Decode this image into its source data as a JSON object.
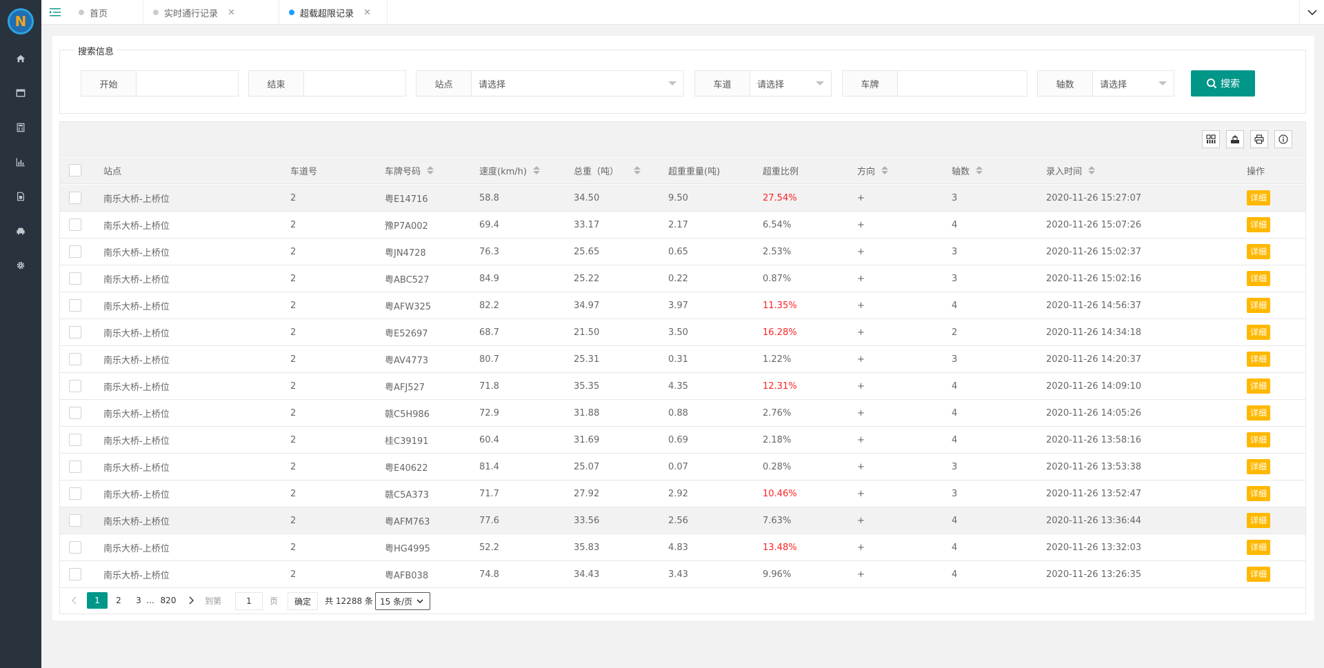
{
  "sidebar": {
    "logo_letter": "N",
    "items": [
      {
        "icon": "home-icon"
      },
      {
        "icon": "window-icon"
      },
      {
        "icon": "calculator-icon"
      },
      {
        "icon": "bar-chart-icon"
      },
      {
        "icon": "document-icon"
      },
      {
        "icon": "car-icon"
      },
      {
        "icon": "gear-icon"
      }
    ]
  },
  "tabs": [
    {
      "label": "首页",
      "active": false,
      "closable": false
    },
    {
      "label": "实时通行记录",
      "active": false,
      "closable": true
    },
    {
      "label": "超载超限记录",
      "active": true,
      "closable": true
    }
  ],
  "search": {
    "legend": "搜索信息",
    "start_label": "开始",
    "start_value": "",
    "end_label": "结束",
    "end_value": "",
    "station_label": "站点",
    "station_value": "请选择",
    "lane_label": "车道",
    "lane_value": "请选择",
    "plate_label": "车牌",
    "plate_value": "",
    "axle_label": "轴数",
    "axle_value": "请选择",
    "button_label": "搜索"
  },
  "table": {
    "columns": [
      "站点",
      "车道号",
      "车牌号码",
      "速度(km/h)",
      "总重（吨）",
      "超重重量(吨)",
      "超重比例",
      "方向",
      "轴数",
      "录入时间",
      "操作"
    ],
    "action_label": "详细",
    "rows": [
      {
        "station": "南乐大桥-上桥位",
        "lane": "2",
        "plate": "粤E14716",
        "speed": "58.8",
        "total": "34.50",
        "over": "9.50",
        "ratio": "27.54%",
        "red": true,
        "dir": "+",
        "axles": "3",
        "time": "2020-11-26 15:27:07"
      },
      {
        "station": "南乐大桥-上桥位",
        "lane": "2",
        "plate": "豫P7A002",
        "speed": "69.4",
        "total": "33.17",
        "over": "2.17",
        "ratio": "6.54%",
        "red": false,
        "dir": "+",
        "axles": "4",
        "time": "2020-11-26 15:07:26"
      },
      {
        "station": "南乐大桥-上桥位",
        "lane": "2",
        "plate": "粤JN4728",
        "speed": "76.3",
        "total": "25.65",
        "over": "0.65",
        "ratio": "2.53%",
        "red": false,
        "dir": "+",
        "axles": "3",
        "time": "2020-11-26 15:02:37"
      },
      {
        "station": "南乐大桥-上桥位",
        "lane": "2",
        "plate": "粤ABC527",
        "speed": "84.9",
        "total": "25.22",
        "over": "0.22",
        "ratio": "0.87%",
        "red": false,
        "dir": "+",
        "axles": "3",
        "time": "2020-11-26 15:02:16"
      },
      {
        "station": "南乐大桥-上桥位",
        "lane": "2",
        "plate": "粤AFW325",
        "speed": "82.2",
        "total": "34.97",
        "over": "3.97",
        "ratio": "11.35%",
        "red": true,
        "dir": "+",
        "axles": "4",
        "time": "2020-11-26 14:56:37"
      },
      {
        "station": "南乐大桥-上桥位",
        "lane": "2",
        "plate": "粤E52697",
        "speed": "68.7",
        "total": "21.50",
        "over": "3.50",
        "ratio": "16.28%",
        "red": true,
        "dir": "+",
        "axles": "2",
        "time": "2020-11-26 14:34:18"
      },
      {
        "station": "南乐大桥-上桥位",
        "lane": "2",
        "plate": "粤AV4773",
        "speed": "80.7",
        "total": "25.31",
        "over": "0.31",
        "ratio": "1.22%",
        "red": false,
        "dir": "+",
        "axles": "3",
        "time": "2020-11-26 14:20:37"
      },
      {
        "station": "南乐大桥-上桥位",
        "lane": "2",
        "plate": "粤AFJ527",
        "speed": "71.8",
        "total": "35.35",
        "over": "4.35",
        "ratio": "12.31%",
        "red": true,
        "dir": "+",
        "axles": "4",
        "time": "2020-11-26 14:09:10"
      },
      {
        "station": "南乐大桥-上桥位",
        "lane": "2",
        "plate": "赣C5H986",
        "speed": "72.9",
        "total": "31.88",
        "over": "0.88",
        "ratio": "2.76%",
        "red": false,
        "dir": "+",
        "axles": "4",
        "time": "2020-11-26 14:05:26"
      },
      {
        "station": "南乐大桥-上桥位",
        "lane": "2",
        "plate": "桂C39191",
        "speed": "60.4",
        "total": "31.69",
        "over": "0.69",
        "ratio": "2.18%",
        "red": false,
        "dir": "+",
        "axles": "4",
        "time": "2020-11-26 13:58:16"
      },
      {
        "station": "南乐大桥-上桥位",
        "lane": "2",
        "plate": "粤E40622",
        "speed": "81.4",
        "total": "25.07",
        "over": "0.07",
        "ratio": "0.28%",
        "red": false,
        "dir": "+",
        "axles": "3",
        "time": "2020-11-26 13:53:38"
      },
      {
        "station": "南乐大桥-上桥位",
        "lane": "2",
        "plate": "赣C5A373",
        "speed": "71.7",
        "total": "27.92",
        "over": "2.92",
        "ratio": "10.46%",
        "red": true,
        "dir": "+",
        "axles": "3",
        "time": "2020-11-26 13:52:47"
      },
      {
        "station": "南乐大桥-上桥位",
        "lane": "2",
        "plate": "粤AFM763",
        "speed": "77.6",
        "total": "33.56",
        "over": "2.56",
        "ratio": "7.63%",
        "red": false,
        "dir": "+",
        "axles": "4",
        "time": "2020-11-26 13:36:44"
      },
      {
        "station": "南乐大桥-上桥位",
        "lane": "2",
        "plate": "粤HG4995",
        "speed": "52.2",
        "total": "35.83",
        "over": "4.83",
        "ratio": "13.48%",
        "red": true,
        "dir": "+",
        "axles": "4",
        "time": "2020-11-26 13:32:03"
      },
      {
        "station": "南乐大桥-上桥位",
        "lane": "2",
        "plate": "粤AFB038",
        "speed": "74.8",
        "total": "34.43",
        "over": "3.43",
        "ratio": "9.96%",
        "red": false,
        "dir": "+",
        "axles": "4",
        "time": "2020-11-26 13:26:35"
      }
    ]
  },
  "pager": {
    "pages": [
      "1",
      "2",
      "3",
      "…",
      "820"
    ],
    "goto_label": "到第",
    "goto_value": "1",
    "page_unit": "页",
    "confirm_label": "确定",
    "total_text": "共 12288 条",
    "page_size": "15 条/页"
  },
  "colors": {
    "primary": "#009688",
    "warn": "#ffb800",
    "danger": "#ff2222",
    "sidebar": "#28333e"
  }
}
